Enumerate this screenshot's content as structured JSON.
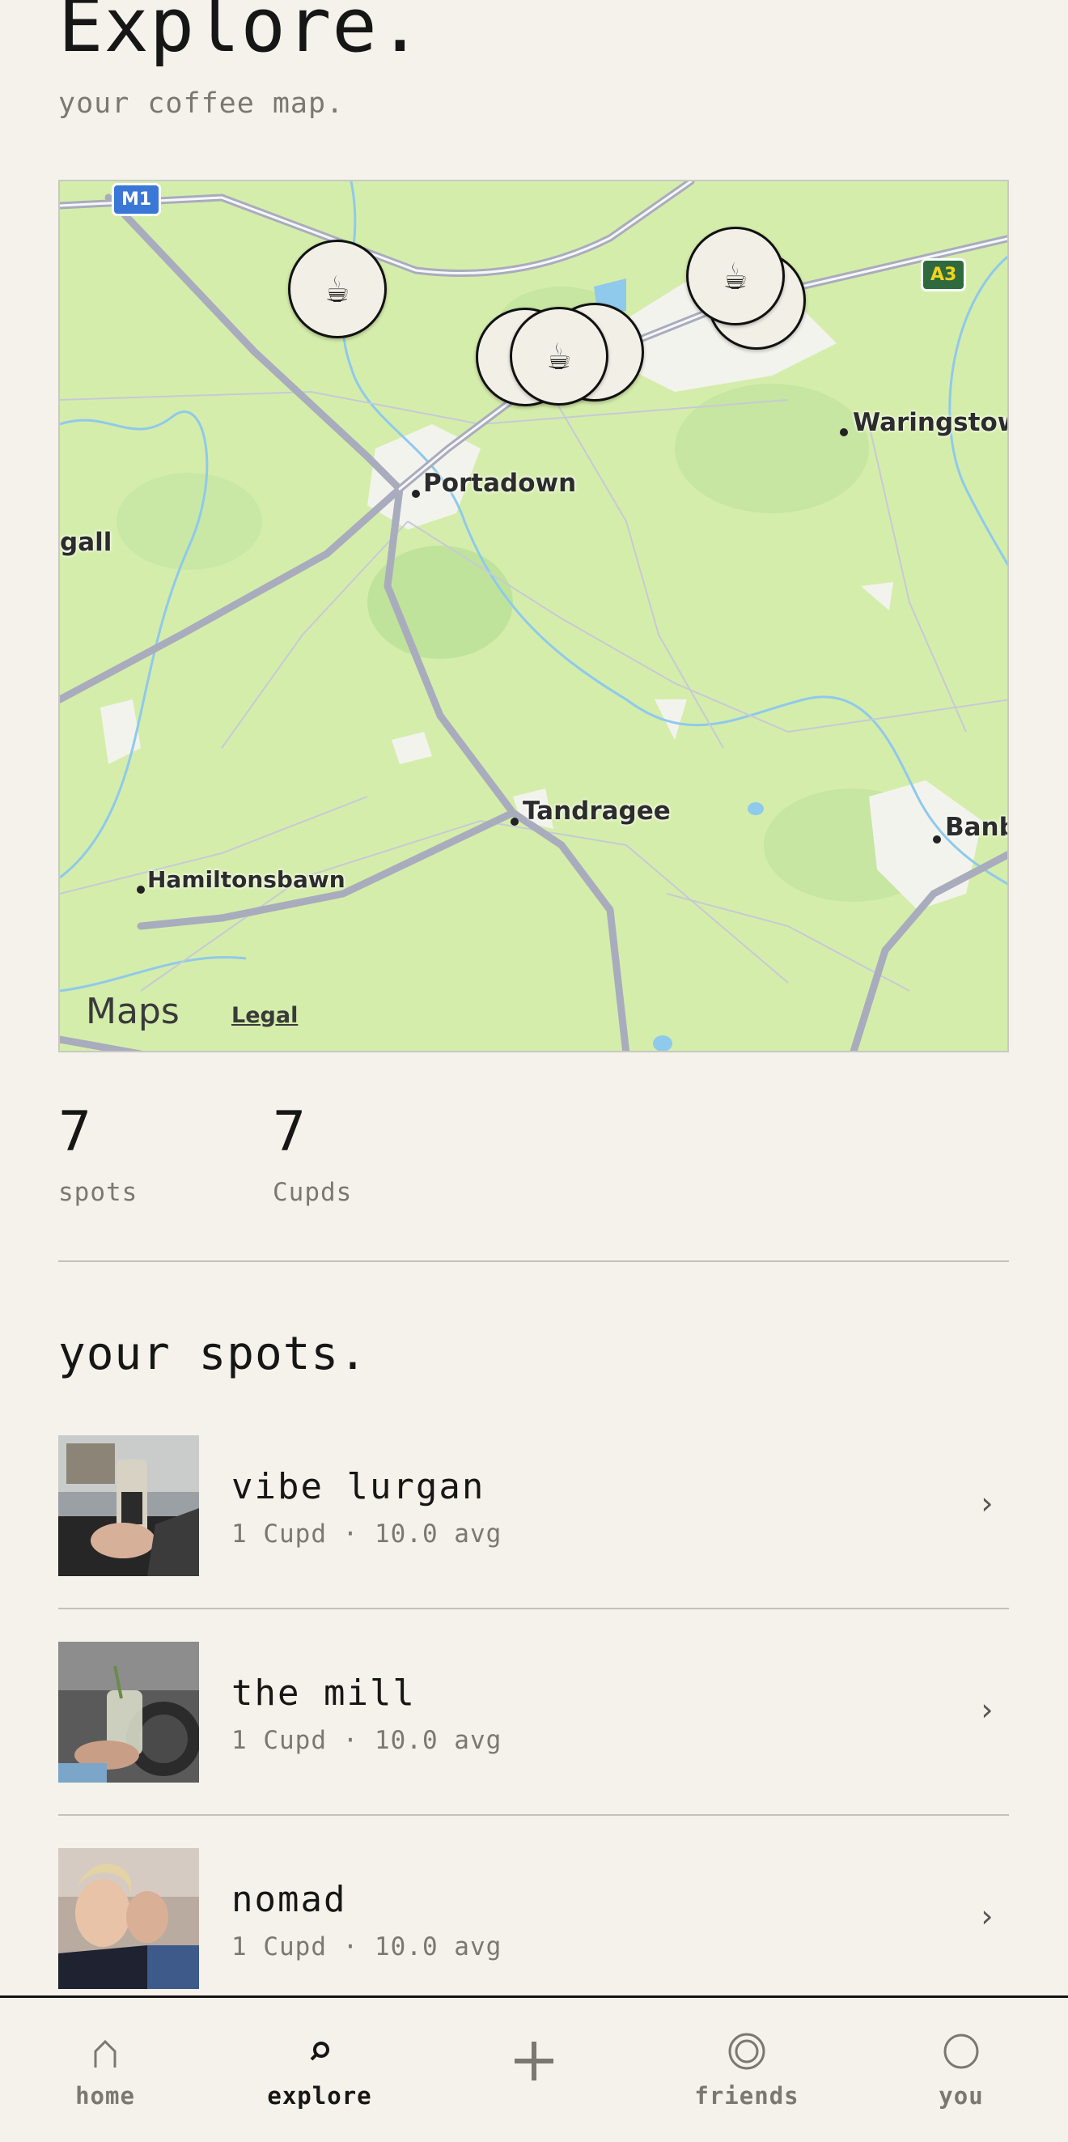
{
  "header": {
    "title": "Explore.",
    "subtitle": "your coffee map."
  },
  "map": {
    "places": [
      "Portadown",
      "Waringstow",
      "gall",
      "Tandragee",
      "Hamiltonsbawn",
      "Banb"
    ],
    "road_shields": [
      "M1",
      "A3"
    ],
    "attribution": "Maps",
    "legal": "Legal",
    "marker_glyph": "☕",
    "apple_glyph": ""
  },
  "stats": [
    {
      "value": "7",
      "label": "spots"
    },
    {
      "value": "7",
      "label": "Cupds"
    }
  ],
  "spots_section": {
    "title": "your spots.",
    "items": [
      {
        "name": "vibe lurgan",
        "meta": "1 Cupd · 10.0 avg"
      },
      {
        "name": "the mill",
        "meta": "1 Cupd · 10.0 avg"
      },
      {
        "name": "nomad",
        "meta": "1 Cupd · 10.0 avg"
      }
    ],
    "chevron": "›"
  },
  "nav": {
    "items": [
      {
        "label": "home",
        "icon": "home-icon"
      },
      {
        "label": "explore",
        "icon": "search-icon"
      },
      {
        "label": "",
        "icon": "plus-icon"
      },
      {
        "label": "friends",
        "icon": "friends-icon"
      },
      {
        "label": "you",
        "icon": "profile-icon"
      }
    ],
    "active": "explore"
  },
  "colors": {
    "background": "#f4f2ea",
    "map_land": "#d5edab",
    "water": "#8fc9ec",
    "road": "#a9acbd",
    "text_muted": "#7b7870"
  }
}
